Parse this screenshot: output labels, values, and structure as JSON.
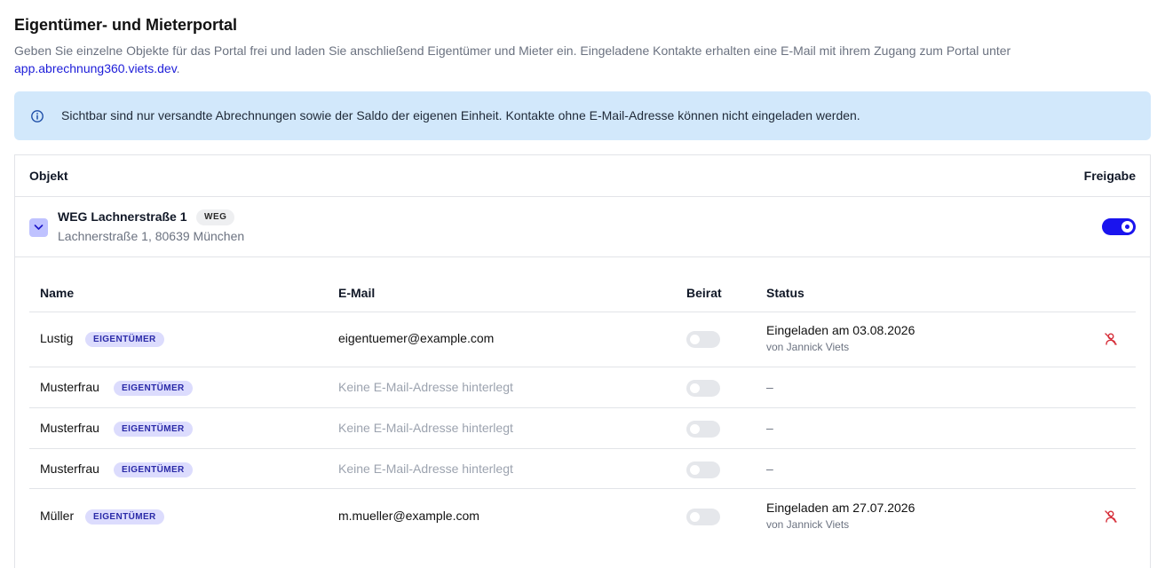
{
  "header": {
    "title": "Eigentümer- und Mieterportal",
    "description": "Geben Sie einzelne Objekte für das Portal frei und laden Sie anschließend Eigentümer und Mieter ein. Eingeladene Kontakte erhalten eine E-Mail mit ihrem Zugang zum Portal unter",
    "link": "app.abrechnung360.viets.dev",
    "link_suffix": "."
  },
  "info": {
    "icon": "info-icon",
    "text": "Sichtbar sind nur versandte Abrechnungen sowie der Saldo der eigenen Einheit. Kontakte ohne E-Mail-Adresse können nicht eingeladen werden."
  },
  "table": {
    "col_objekt": "Objekt",
    "col_freigabe": "Freigabe",
    "object": {
      "name": "WEG Lachnerstraße 1",
      "badge": "WEG",
      "address": "Lachnerstraße 1, 80639 München",
      "released": true
    }
  },
  "contacts": {
    "headers": {
      "name": "Name",
      "email": "E-Mail",
      "beirat": "Beirat",
      "status": "Status"
    },
    "rows": [
      {
        "name": "Lustig",
        "role": "EIGENTÜMER",
        "email": "eigentuemer@example.com",
        "beirat": false,
        "status": "Eingeladen am 03.08.2026",
        "status_by": "von Jannick Viets"
      },
      {
        "name": "Musterfrau",
        "role": "EIGENTÜMER",
        "email": "Keine E-Mail-Adresse hinterlegt",
        "beirat": false,
        "status": "–"
      },
      {
        "name": "Musterfrau",
        "role": "EIGENTÜMER",
        "email": "Keine E-Mail-Adresse hinterlegt",
        "beirat": false,
        "status": "–"
      },
      {
        "name": "Musterfrau",
        "role": "EIGENTÜMER",
        "email": "Keine E-Mail-Adresse hinterlegt",
        "beirat": false,
        "status": "–"
      },
      {
        "name": "Müller",
        "role": "EIGENTÜMER",
        "email": "m.mueller@example.com",
        "beirat": false,
        "status": "Eingeladen am 27.07.2026",
        "status_by": "von Jannick Viets"
      }
    ]
  },
  "colors": {
    "accent": "#1a14ee",
    "info_bg": "#d2e8fb",
    "badge_bg": "#dcdcfd",
    "revoke": "#d62f3a"
  }
}
